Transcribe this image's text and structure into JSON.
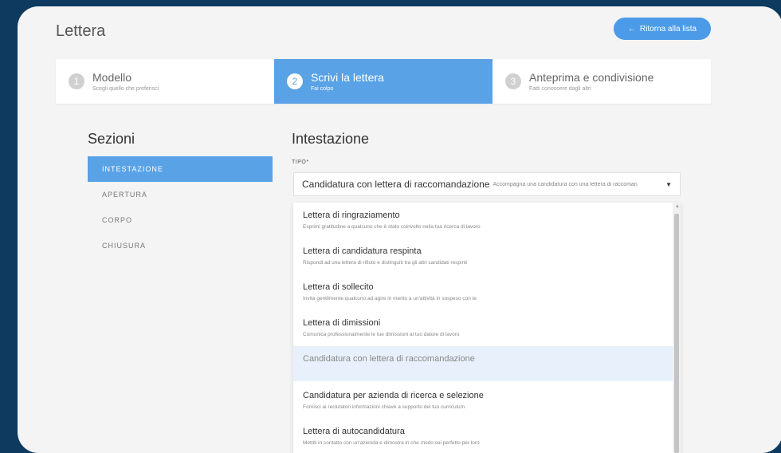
{
  "page_title": "Lettera",
  "back_button": {
    "label": "Ritorna alla lista",
    "icon": "arrow-left-icon"
  },
  "steps": [
    {
      "number": "1",
      "title": "Modello",
      "subtitle": "Scegli quello che preferisci",
      "active": false
    },
    {
      "number": "2",
      "title": "Scrivi la lettera",
      "subtitle": "Fai colpo",
      "active": true
    },
    {
      "number": "3",
      "title": "Anteprima e condivisione",
      "subtitle": "Fatti conoscere dagli altri",
      "active": false
    }
  ],
  "sidebar": {
    "title": "Sezioni",
    "items": [
      {
        "label": "INTESTAZIONE",
        "active": true
      },
      {
        "label": "APERTURA"
      },
      {
        "label": "CORPO"
      },
      {
        "label": "CHIUSURA"
      }
    ]
  },
  "main": {
    "title": "Intestazione",
    "field_label": "TIPO*",
    "select": {
      "value": "Candidatura con lettera di raccomandazione",
      "description": "Accompagna una candidatura con una lettera di raccoman"
    },
    "options": [
      {
        "label": "Lettera di ringraziamento",
        "description": "Esprimi gratitudine a qualcuno che è stato coinvolto nella tua ricerca di lavoro"
      },
      {
        "label": "Lettera di candidatura respinta",
        "description": "Rispondi ad una lettera di rifiuto e distinguiti tra gli altri candidati respinti"
      },
      {
        "label": "Lettera di sollecito",
        "description": "Invita gentilmente qualcuno ad agire in merito a un'attività in sospeso con te"
      },
      {
        "label": "Lettera di dimissioni",
        "description": "Comunica professionalmente le tue dimissioni al tuo datore di lavoro"
      },
      {
        "label": "Candidatura con lettera di raccomandazione",
        "description": "",
        "selected": true
      },
      {
        "label": "Candidatura per azienda di ricerca e selezione",
        "description": "Fornisci ai reclutatori informazioni chiave a supporto del tuo curriculum"
      },
      {
        "label": "Lettera di autocandidatura",
        "description": "Mettiti in contatto con un'azienda e dimostra in che modo sei perfetto per loro"
      }
    ]
  },
  "colors": {
    "background": "#0d3a5e",
    "accent": "#5aa2e6",
    "button": "#4c9be8"
  }
}
